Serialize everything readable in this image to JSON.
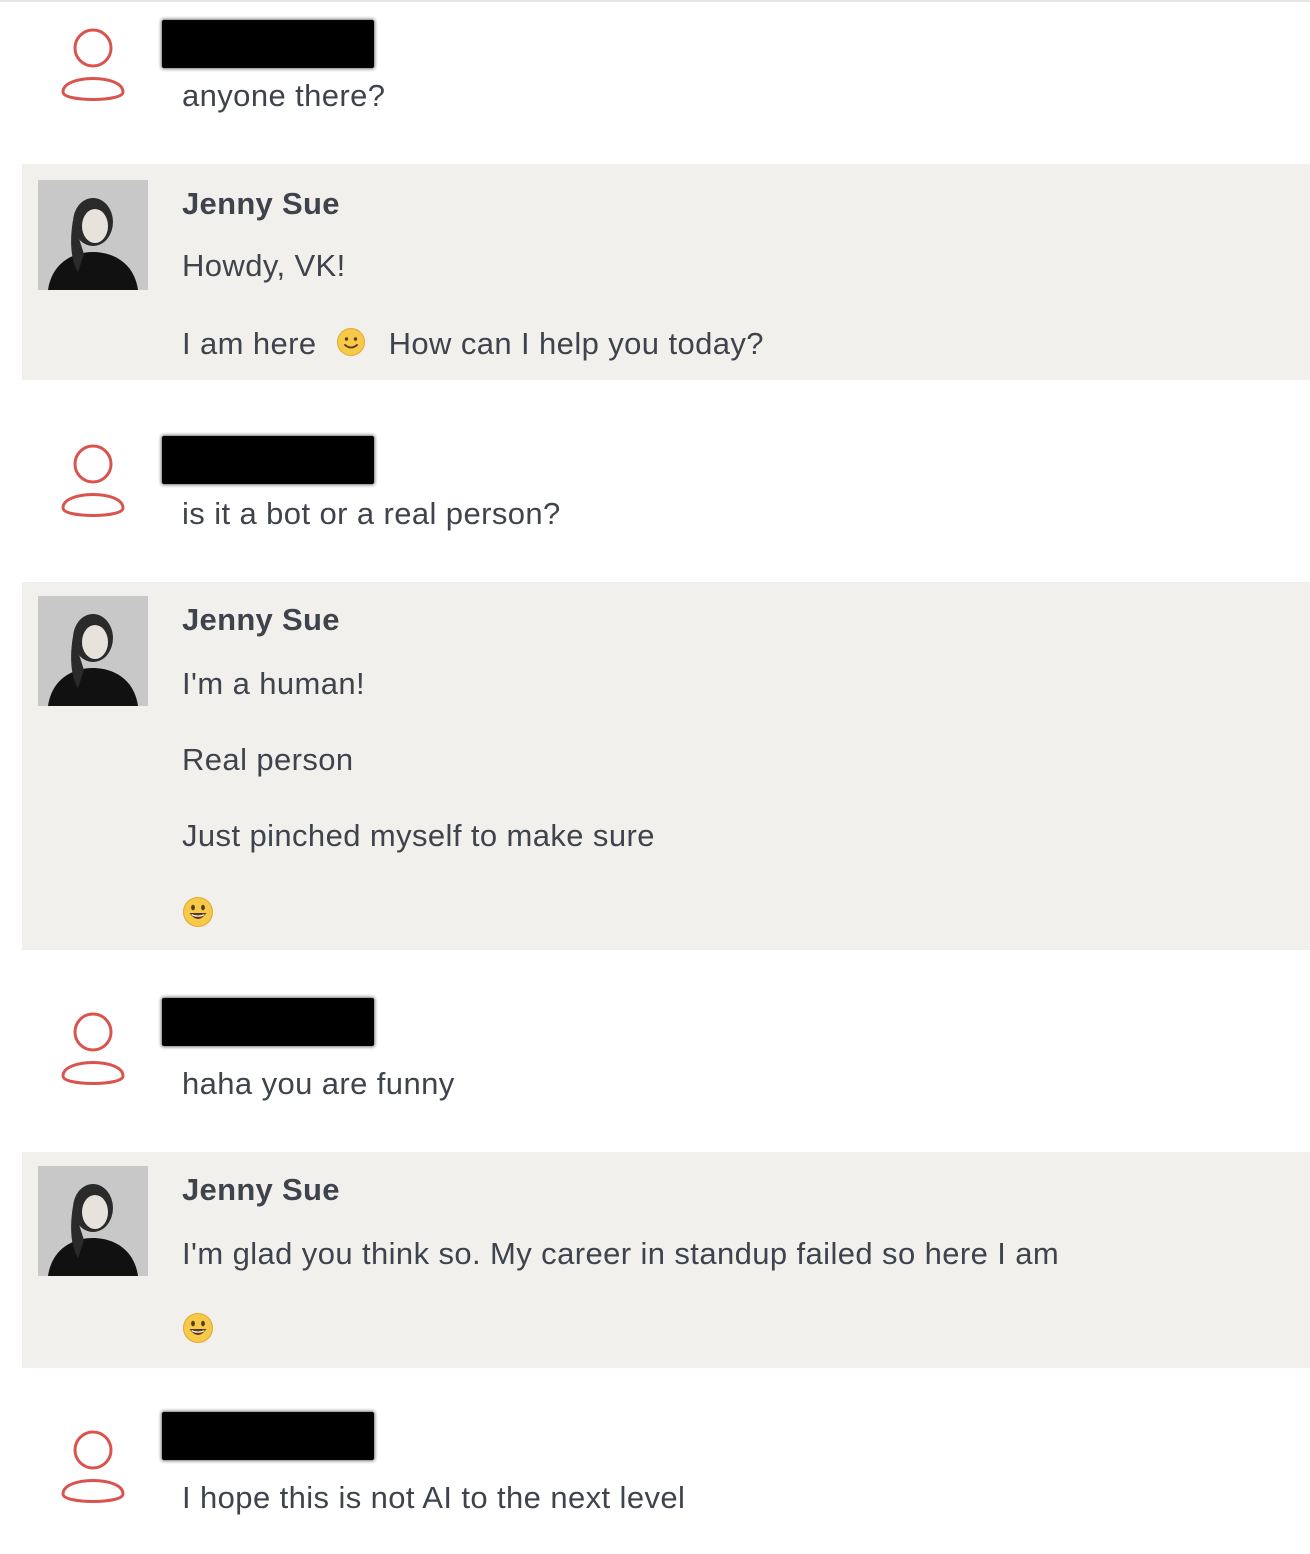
{
  "messages": [
    {
      "sender": "visitor",
      "name_redacted": true,
      "lines": [
        "anyone there?"
      ]
    },
    {
      "sender": "agent",
      "name": "Jenny Sue",
      "lines": [
        "Howdy, VK!",
        "I am here",
        "How can I help you today?"
      ],
      "emoji": [
        "slightly-smiling-face-icon"
      ]
    },
    {
      "sender": "visitor",
      "name_redacted": true,
      "lines": [
        "is it a bot or a real person?"
      ]
    },
    {
      "sender": "agent",
      "name": "Jenny Sue",
      "lines": [
        "I'm a human!",
        "Real person",
        "Just pinched myself to make sure"
      ],
      "emoji": [
        "grinning-face-icon"
      ]
    },
    {
      "sender": "visitor",
      "name_redacted": true,
      "lines": [
        "haha you are funny"
      ]
    },
    {
      "sender": "agent",
      "name": "Jenny Sue",
      "lines": [
        "I'm glad you think so. My career in standup failed so here I am"
      ],
      "emoji": [
        "grinning-face-icon"
      ]
    },
    {
      "sender": "visitor",
      "name_redacted": true,
      "lines": [
        "I hope this is not AI to the next level"
      ]
    }
  ],
  "colors": {
    "agent_background": "#f1f0ed",
    "visitor_icon": "#d9534f",
    "text": "#3f434c",
    "emoji_yellow": "#f7c948"
  }
}
